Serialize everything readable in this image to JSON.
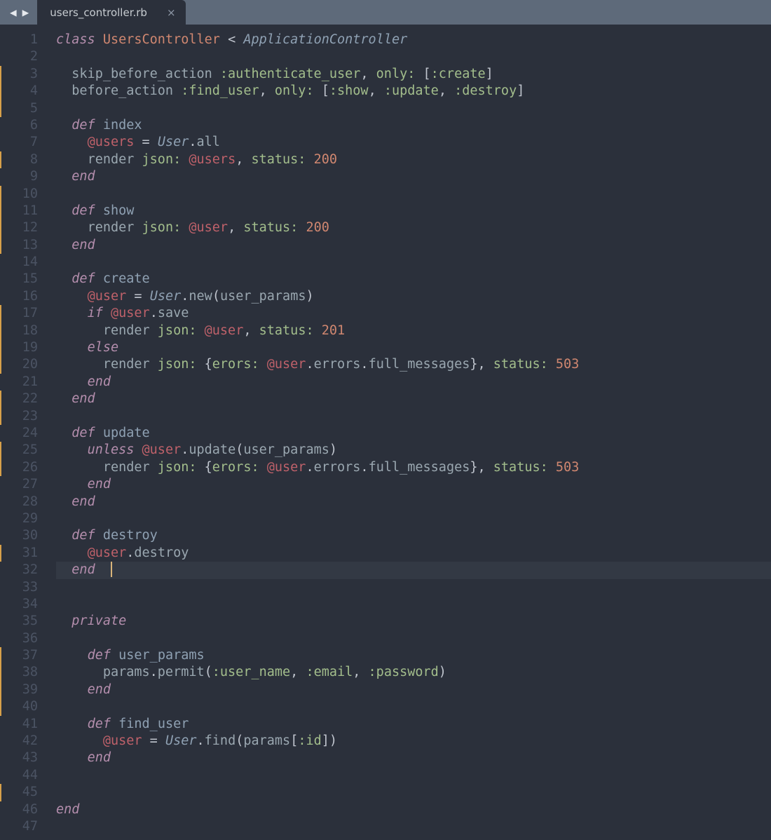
{
  "titlebar": {
    "prev_icon": "◀",
    "next_icon": "▶"
  },
  "tab": {
    "filename": "users_controller.rb",
    "close_icon": "×"
  },
  "editor": {
    "active_line": 32,
    "modified_lines": [
      3,
      4,
      5,
      8,
      10,
      11,
      12,
      13,
      17,
      18,
      19,
      20,
      22,
      23,
      25,
      26,
      31,
      37,
      38,
      39,
      40,
      45
    ],
    "guide_cols": [
      2,
      4,
      6
    ],
    "lines": [
      {
        "n": 1,
        "tokens": [
          [
            "kw",
            "class"
          ],
          [
            "punc",
            " "
          ],
          [
            "cls",
            "UsersController"
          ],
          [
            "punc",
            " "
          ],
          [
            "op",
            "<"
          ],
          [
            "punc",
            " "
          ],
          [
            "typ",
            "ApplicationController"
          ]
        ]
      },
      {
        "n": 2,
        "tokens": []
      },
      {
        "n": 3,
        "tokens": [
          [
            "punc",
            "  "
          ],
          [
            "call",
            "skip_before_action"
          ],
          [
            "punc",
            " "
          ],
          [
            "sym",
            ":authenticate_user"
          ],
          [
            "punc",
            ", "
          ],
          [
            "key",
            "only:"
          ],
          [
            "punc",
            " ["
          ],
          [
            "sym",
            ":create"
          ],
          [
            "punc",
            "]"
          ]
        ]
      },
      {
        "n": 4,
        "tokens": [
          [
            "punc",
            "  "
          ],
          [
            "call",
            "before_action"
          ],
          [
            "punc",
            " "
          ],
          [
            "sym",
            ":find_user"
          ],
          [
            "punc",
            ", "
          ],
          [
            "key",
            "only:"
          ],
          [
            "punc",
            " ["
          ],
          [
            "sym",
            ":show"
          ],
          [
            "punc",
            ", "
          ],
          [
            "sym",
            ":update"
          ],
          [
            "punc",
            ", "
          ],
          [
            "sym",
            ":destroy"
          ],
          [
            "punc",
            "]"
          ]
        ]
      },
      {
        "n": 5,
        "tokens": []
      },
      {
        "n": 6,
        "tokens": [
          [
            "punc",
            "  "
          ],
          [
            "kw",
            "def"
          ],
          [
            "punc",
            " "
          ],
          [
            "mth",
            "index"
          ]
        ]
      },
      {
        "n": 7,
        "tokens": [
          [
            "punc",
            "    "
          ],
          [
            "ivar",
            "@users"
          ],
          [
            "punc",
            " "
          ],
          [
            "op",
            "="
          ],
          [
            "punc",
            " "
          ],
          [
            "typ",
            "User"
          ],
          [
            "punc",
            "."
          ],
          [
            "call",
            "all"
          ]
        ]
      },
      {
        "n": 8,
        "tokens": [
          [
            "punc",
            "    "
          ],
          [
            "call",
            "render"
          ],
          [
            "punc",
            " "
          ],
          [
            "key",
            "json:"
          ],
          [
            "punc",
            " "
          ],
          [
            "ivar",
            "@users"
          ],
          [
            "punc",
            ", "
          ],
          [
            "key",
            "status:"
          ],
          [
            "punc",
            " "
          ],
          [
            "num",
            "200"
          ]
        ]
      },
      {
        "n": 9,
        "tokens": [
          [
            "punc",
            "  "
          ],
          [
            "kw",
            "end"
          ]
        ]
      },
      {
        "n": 10,
        "tokens": []
      },
      {
        "n": 11,
        "tokens": [
          [
            "punc",
            "  "
          ],
          [
            "kw",
            "def"
          ],
          [
            "punc",
            " "
          ],
          [
            "mth",
            "show"
          ]
        ]
      },
      {
        "n": 12,
        "tokens": [
          [
            "punc",
            "    "
          ],
          [
            "call",
            "render"
          ],
          [
            "punc",
            " "
          ],
          [
            "key",
            "json:"
          ],
          [
            "punc",
            " "
          ],
          [
            "ivar",
            "@user"
          ],
          [
            "punc",
            ", "
          ],
          [
            "key",
            "status:"
          ],
          [
            "punc",
            " "
          ],
          [
            "num",
            "200"
          ]
        ]
      },
      {
        "n": 13,
        "tokens": [
          [
            "punc",
            "  "
          ],
          [
            "kw",
            "end"
          ]
        ]
      },
      {
        "n": 14,
        "tokens": []
      },
      {
        "n": 15,
        "tokens": [
          [
            "punc",
            "  "
          ],
          [
            "kw",
            "def"
          ],
          [
            "punc",
            " "
          ],
          [
            "mth",
            "create"
          ]
        ]
      },
      {
        "n": 16,
        "tokens": [
          [
            "punc",
            "    "
          ],
          [
            "ivar",
            "@user"
          ],
          [
            "punc",
            " "
          ],
          [
            "op",
            "="
          ],
          [
            "punc",
            " "
          ],
          [
            "typ",
            "User"
          ],
          [
            "punc",
            "."
          ],
          [
            "call",
            "new"
          ],
          [
            "punc",
            "("
          ],
          [
            "call",
            "user_params"
          ],
          [
            "punc",
            ")"
          ]
        ]
      },
      {
        "n": 17,
        "tokens": [
          [
            "punc",
            "    "
          ],
          [
            "kw",
            "if"
          ],
          [
            "punc",
            " "
          ],
          [
            "ivar",
            "@user"
          ],
          [
            "punc",
            "."
          ],
          [
            "call",
            "save"
          ]
        ]
      },
      {
        "n": 18,
        "tokens": [
          [
            "punc",
            "      "
          ],
          [
            "call",
            "render"
          ],
          [
            "punc",
            " "
          ],
          [
            "key",
            "json:"
          ],
          [
            "punc",
            " "
          ],
          [
            "ivar",
            "@user"
          ],
          [
            "punc",
            ", "
          ],
          [
            "key",
            "status:"
          ],
          [
            "punc",
            " "
          ],
          [
            "num",
            "201"
          ]
        ]
      },
      {
        "n": 19,
        "tokens": [
          [
            "punc",
            "    "
          ],
          [
            "kw",
            "else"
          ]
        ]
      },
      {
        "n": 20,
        "tokens": [
          [
            "punc",
            "      "
          ],
          [
            "call",
            "render"
          ],
          [
            "punc",
            " "
          ],
          [
            "key",
            "json:"
          ],
          [
            "punc",
            " {"
          ],
          [
            "key",
            "erors:"
          ],
          [
            "punc",
            " "
          ],
          [
            "ivar",
            "@user"
          ],
          [
            "punc",
            "."
          ],
          [
            "call",
            "errors"
          ],
          [
            "punc",
            "."
          ],
          [
            "call",
            "full_messages"
          ],
          [
            "punc",
            "}, "
          ],
          [
            "key",
            "status:"
          ],
          [
            "punc",
            " "
          ],
          [
            "num",
            "503"
          ]
        ]
      },
      {
        "n": 21,
        "tokens": [
          [
            "punc",
            "    "
          ],
          [
            "kw",
            "end"
          ]
        ]
      },
      {
        "n": 22,
        "tokens": [
          [
            "punc",
            "  "
          ],
          [
            "kw",
            "end"
          ]
        ]
      },
      {
        "n": 23,
        "tokens": []
      },
      {
        "n": 24,
        "tokens": [
          [
            "punc",
            "  "
          ],
          [
            "kw",
            "def"
          ],
          [
            "punc",
            " "
          ],
          [
            "mth",
            "update"
          ]
        ]
      },
      {
        "n": 25,
        "tokens": [
          [
            "punc",
            "    "
          ],
          [
            "kw",
            "unless"
          ],
          [
            "punc",
            " "
          ],
          [
            "ivar",
            "@user"
          ],
          [
            "punc",
            "."
          ],
          [
            "call",
            "update"
          ],
          [
            "punc",
            "("
          ],
          [
            "call",
            "user_params"
          ],
          [
            "punc",
            ")"
          ]
        ]
      },
      {
        "n": 26,
        "tokens": [
          [
            "punc",
            "      "
          ],
          [
            "call",
            "render"
          ],
          [
            "punc",
            " "
          ],
          [
            "key",
            "json:"
          ],
          [
            "punc",
            " {"
          ],
          [
            "key",
            "erors:"
          ],
          [
            "punc",
            " "
          ],
          [
            "ivar",
            "@user"
          ],
          [
            "punc",
            "."
          ],
          [
            "call",
            "errors"
          ],
          [
            "punc",
            "."
          ],
          [
            "call",
            "full_messages"
          ],
          [
            "punc",
            "}, "
          ],
          [
            "key",
            "status:"
          ],
          [
            "punc",
            " "
          ],
          [
            "num",
            "503"
          ]
        ]
      },
      {
        "n": 27,
        "tokens": [
          [
            "punc",
            "    "
          ],
          [
            "kw",
            "end"
          ]
        ]
      },
      {
        "n": 28,
        "tokens": [
          [
            "punc",
            "  "
          ],
          [
            "kw",
            "end"
          ]
        ]
      },
      {
        "n": 29,
        "tokens": []
      },
      {
        "n": 30,
        "tokens": [
          [
            "punc",
            "  "
          ],
          [
            "kw",
            "def"
          ],
          [
            "punc",
            " "
          ],
          [
            "mth",
            "destroy"
          ]
        ]
      },
      {
        "n": 31,
        "tokens": [
          [
            "punc",
            "    "
          ],
          [
            "ivar",
            "@user"
          ],
          [
            "punc",
            "."
          ],
          [
            "call",
            "destroy"
          ]
        ]
      },
      {
        "n": 32,
        "tokens": [
          [
            "punc",
            "  "
          ],
          [
            "kw",
            "end"
          ],
          [
            "punc",
            "  "
          ],
          [
            "cursor",
            ""
          ]
        ]
      },
      {
        "n": 33,
        "tokens": []
      },
      {
        "n": 34,
        "tokens": []
      },
      {
        "n": 35,
        "tokens": [
          [
            "punc",
            "  "
          ],
          [
            "kw",
            "private"
          ]
        ]
      },
      {
        "n": 36,
        "tokens": []
      },
      {
        "n": 37,
        "tokens": [
          [
            "punc",
            "    "
          ],
          [
            "kw",
            "def"
          ],
          [
            "punc",
            " "
          ],
          [
            "mth",
            "user_params"
          ]
        ]
      },
      {
        "n": 38,
        "tokens": [
          [
            "punc",
            "      "
          ],
          [
            "call",
            "params"
          ],
          [
            "punc",
            "."
          ],
          [
            "call",
            "permit"
          ],
          [
            "punc",
            "("
          ],
          [
            "sym",
            ":user_name"
          ],
          [
            "punc",
            ", "
          ],
          [
            "sym",
            ":email"
          ],
          [
            "punc",
            ", "
          ],
          [
            "sym",
            ":password"
          ],
          [
            "punc",
            ")"
          ]
        ]
      },
      {
        "n": 39,
        "tokens": [
          [
            "punc",
            "    "
          ],
          [
            "kw",
            "end"
          ]
        ]
      },
      {
        "n": 40,
        "tokens": []
      },
      {
        "n": 41,
        "tokens": [
          [
            "punc",
            "    "
          ],
          [
            "kw",
            "def"
          ],
          [
            "punc",
            " "
          ],
          [
            "mth",
            "find_user"
          ]
        ]
      },
      {
        "n": 42,
        "tokens": [
          [
            "punc",
            "      "
          ],
          [
            "ivar",
            "@user"
          ],
          [
            "punc",
            " "
          ],
          [
            "op",
            "="
          ],
          [
            "punc",
            " "
          ],
          [
            "typ",
            "User"
          ],
          [
            "punc",
            "."
          ],
          [
            "call",
            "find"
          ],
          [
            "punc",
            "("
          ],
          [
            "call",
            "params"
          ],
          [
            "punc",
            "["
          ],
          [
            "sym",
            ":id"
          ],
          [
            "punc",
            "])"
          ]
        ]
      },
      {
        "n": 43,
        "tokens": [
          [
            "punc",
            "    "
          ],
          [
            "kw",
            "end"
          ]
        ]
      },
      {
        "n": 44,
        "tokens": []
      },
      {
        "n": 45,
        "tokens": []
      },
      {
        "n": 46,
        "tokens": [
          [
            "kw",
            "end"
          ]
        ]
      },
      {
        "n": 47,
        "tokens": []
      }
    ]
  }
}
